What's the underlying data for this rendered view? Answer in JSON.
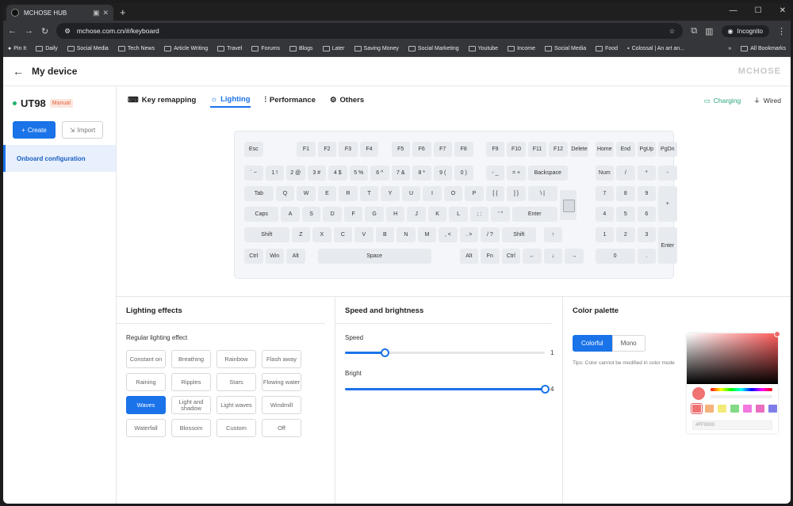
{
  "browser": {
    "tab_title": "MCHOSE HUB",
    "url": "mchose.com.cn/#/keyboard",
    "incognito_label": "Incognito",
    "bookmarks": [
      "Pin It",
      "Daily",
      "Social Media",
      "Tech News",
      "Article Writing",
      "Travel",
      "Forums",
      "Blogs",
      "Later",
      "Saving Money",
      "Social Marketing",
      "Youtube",
      "Income",
      "Social Media",
      "Food",
      "Colossal | An art an..."
    ],
    "all_bookmarks": "All Bookmarks"
  },
  "header": {
    "back_icon": "arrow-left-icon",
    "title": "My device",
    "logo": "MCHOSE"
  },
  "sidebar": {
    "device_name": "UT98",
    "mode_badge": "Manual",
    "create_label": "Create",
    "import_label": "Import",
    "onboard_label": "Onboard configuration"
  },
  "tabs": [
    {
      "label": "Key remapping",
      "icon": "keyboard-icon"
    },
    {
      "label": "Lighting",
      "icon": "bulb-icon",
      "active": true
    },
    {
      "label": "Performance",
      "icon": "sliders-icon"
    },
    {
      "label": "Others",
      "icon": "gear-icon"
    }
  ],
  "status": {
    "charging": "Charging",
    "wired": "Wired"
  },
  "keyboard": {
    "keys": {
      "esc": "Esc",
      "f1": "F1",
      "f2": "F2",
      "f3": "F3",
      "f4": "F4",
      "f5": "F5",
      "f6": "F6",
      "f7": "F7",
      "f8": "F8",
      "f9": "F9",
      "f10": "F10",
      "f11": "F11",
      "f12": "F12",
      "del": "Delete",
      "home": "Home",
      "end": "End",
      "pgup": "PgUp",
      "pgdn": "PgDn",
      "grave": "` ~",
      "k1": "1 !",
      "k2": "2 @",
      "k3": "3 #",
      "k4": "4 $",
      "k5": "5 %",
      "k6": "6 ^",
      "k7": "7 &",
      "k8": "8 *",
      "k9": "9 (",
      "k0": "0 )",
      "minus": "- _",
      "equal": "= +",
      "bksp": "Backspace",
      "num": "Num",
      "ndiv": "/",
      "nmul": "*",
      "nsub": "-",
      "tab": "Tab",
      "q": "Q",
      "w": "W",
      "e": "E",
      "r": "R",
      "t": "T",
      "y": "Y",
      "u": "U",
      "i": "I",
      "o": "O",
      "p": "P",
      "lbr": "[ {",
      "rbr": "] }",
      "bsl": "\\ |",
      "n7": "7",
      "n8": "8",
      "n9": "9",
      "nadd": "+",
      "caps": "Caps",
      "a": "A",
      "s": "S",
      "d": "D",
      "f": "F",
      "g": "G",
      "h": "H",
      "j": "J",
      "k": "K",
      "l": "L",
      "semi": "; :",
      "quote": "' \"",
      "enter": "Enter",
      "n4": "4",
      "n5": "5",
      "n6": "6",
      "lshift": "Shift",
      "z": "Z",
      "x": "X",
      "c": "C",
      "v": "V",
      "b": "B",
      "n": "N",
      "m": "M",
      "comma": ", <",
      "dot": ". >",
      "slash": "/ ?",
      "rshift": "Shift",
      "up": "↑",
      "n1": "1",
      "n2": "2",
      "n3": "3",
      "nent": "Enter",
      "lctrl": "Ctrl",
      "win": "Win",
      "lalt": "Alt",
      "space": "Space",
      "ralt": "Alt",
      "fn": "Fn",
      "rctrl": "Ctrl",
      "left": "←",
      "down": "↓",
      "right": "→",
      "n0": "0",
      "ndot": "."
    }
  },
  "lighting_effects": {
    "title": "Lighting effects",
    "subtitle": "Regular lighting effect",
    "items": [
      "Constant on",
      "Breathing",
      "Rainbow",
      "Flash away",
      "Raining",
      "Ripples",
      "Stars",
      "Flowing water",
      "Waves",
      "Light and shadow",
      "Light waves",
      "Windmill",
      "Waterfall",
      "Blossom",
      "Custom",
      "Off"
    ],
    "selected": "Waves"
  },
  "speed_brightness": {
    "title": "Speed and brightness",
    "speed_label": "Speed",
    "speed_value": "1",
    "speed_fraction": 0.2,
    "brightness_label": "Bright",
    "brightness_value": "4",
    "brightness_fraction": 1.0
  },
  "color_palette": {
    "title": "Color palette",
    "colorful_label": "Colorful",
    "mono_label": "Mono",
    "tips": "Tips:  Color cannot be modified in color mode",
    "hex_value": "#FF0000",
    "swatches": [
      "#f07272",
      "#f5b27a",
      "#f3ea7a",
      "#84d986",
      "#f078e0",
      "#ea6ec0",
      "#7e7ee8"
    ],
    "accent": "#1a73e8"
  }
}
